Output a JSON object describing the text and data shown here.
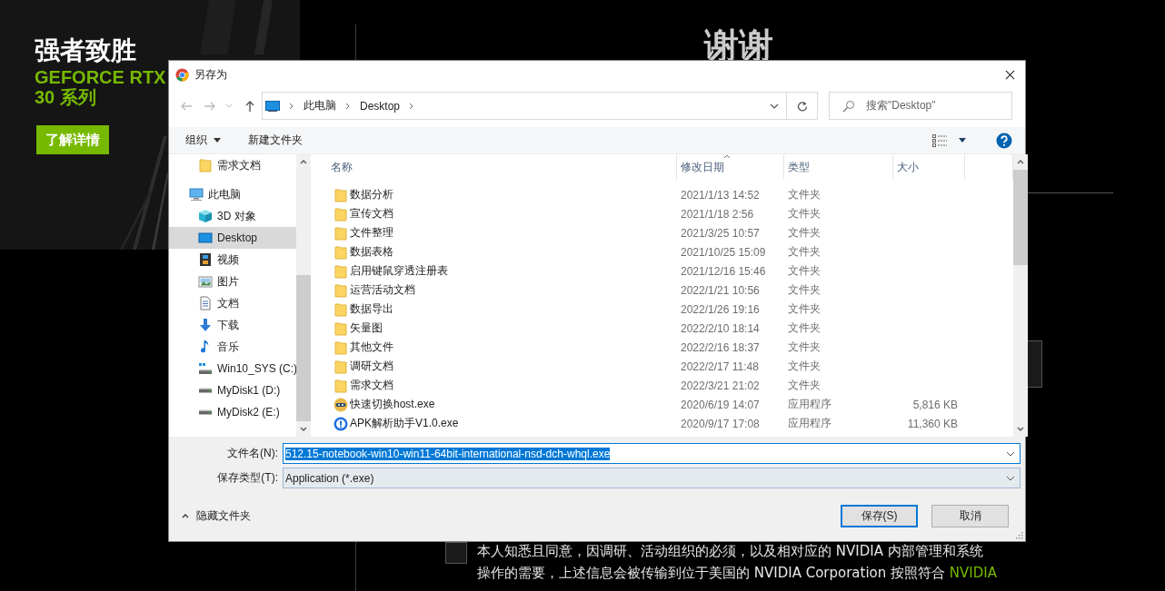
{
  "page": {
    "promo": {
      "headline": "强者致胜",
      "brand": "GEFORCE RTX",
      "series": "30 系列",
      "button": "了解详情"
    },
    "title": "谢谢",
    "consent": {
      "checked": false,
      "lines": [
        "本人知悉且同意，因调研、活动组织的必须，以及相对应的 NVIDIA 内部管理和系统",
        "操作的需要，上述信息会被传输到位于美国的 NVIDIA Corporation 按照符合 "
      ],
      "link": "NVIDIA"
    }
  },
  "dialog": {
    "title": "另存为",
    "breadcrumb": [
      "此电脑",
      "Desktop"
    ],
    "search": {
      "placeholder": "搜索\"Desktop\""
    },
    "toolbar": {
      "organize": "组织",
      "new_folder": "新建文件夹"
    },
    "nav": [
      {
        "label": "需求文档",
        "kind": "folder",
        "selected": false
      },
      {
        "label": "此电脑",
        "kind": "computer",
        "selected": false,
        "children": [
          {
            "label": "3D 对象",
            "kind": "cube",
            "selected": false
          },
          {
            "label": "Desktop",
            "kind": "desktop",
            "selected": true
          },
          {
            "label": "视频",
            "kind": "video",
            "selected": false
          },
          {
            "label": "图片",
            "kind": "picture",
            "selected": false
          },
          {
            "label": "文档",
            "kind": "document",
            "selected": false
          },
          {
            "label": "下载",
            "kind": "download",
            "selected": false
          },
          {
            "label": "音乐",
            "kind": "music",
            "selected": false
          },
          {
            "label": "Win10_SYS (C:)",
            "kind": "system-drive",
            "selected": false
          },
          {
            "label": "MyDisk1 (D:)",
            "kind": "drive",
            "selected": false
          },
          {
            "label": "MyDisk2 (E:)",
            "kind": "drive",
            "selected": false
          }
        ]
      }
    ],
    "columns": [
      {
        "label": "名称",
        "sorted": false
      },
      {
        "label": "修改日期",
        "sorted": true
      },
      {
        "label": "类型",
        "sorted": false
      },
      {
        "label": "大小",
        "sorted": false
      }
    ],
    "files": [
      {
        "name": "数据分析",
        "date": "2021/1/13 14:52",
        "type": "文件夹",
        "kind": "folder"
      },
      {
        "name": "宣传文档",
        "date": "2021/1/18 2:56",
        "type": "文件夹",
        "kind": "folder"
      },
      {
        "name": "文件整理",
        "date": "2021/3/25 10:57",
        "type": "文件夹",
        "kind": "folder"
      },
      {
        "name": "数据表格",
        "date": "2021/10/25 15:09",
        "type": "文件夹",
        "kind": "folder"
      },
      {
        "name": "启用键鼠穿透注册表",
        "date": "2021/12/16 15:46",
        "type": "文件夹",
        "kind": "folder"
      },
      {
        "name": "运营活动文档",
        "date": "2022/1/21 10:56",
        "type": "文件夹",
        "kind": "folder"
      },
      {
        "name": "数据导出",
        "date": "2022/1/26 19:16",
        "type": "文件夹",
        "kind": "folder"
      },
      {
        "name": "矢量图",
        "date": "2022/2/10 18:14",
        "type": "文件夹",
        "kind": "folder"
      },
      {
        "name": "其他文件",
        "date": "2022/2/16 18:37",
        "type": "文件夹",
        "kind": "folder"
      },
      {
        "name": "调研文档",
        "date": "2022/2/17 11:48",
        "type": "文件夹",
        "kind": "folder"
      },
      {
        "name": "需求文档",
        "date": "2022/3/21 21:02",
        "type": "文件夹",
        "kind": "folder"
      },
      {
        "name": "快速切换host.exe",
        "date": "2020/6/19 14:07",
        "type": "应用程序",
        "size": "5,816 KB",
        "kind": "tool-app"
      },
      {
        "name": "APK解析助手V1.0.exe",
        "date": "2020/9/17 17:08",
        "type": "应用程序",
        "size": "11,360 KB",
        "kind": "info-app"
      }
    ],
    "filename": {
      "label": "文件名(N):",
      "value": "512.15-notebook-win10-win11-64bit-international-nsd-dch-whql.exe",
      "selected": true
    },
    "filetype": {
      "label": "保存类型(T):",
      "value": "Application (*.exe)"
    },
    "hide_folders": "隐藏文件夹",
    "buttons": [
      {
        "label": "保存(S)",
        "default": true
      },
      {
        "label": "取消",
        "default": false
      }
    ]
  }
}
